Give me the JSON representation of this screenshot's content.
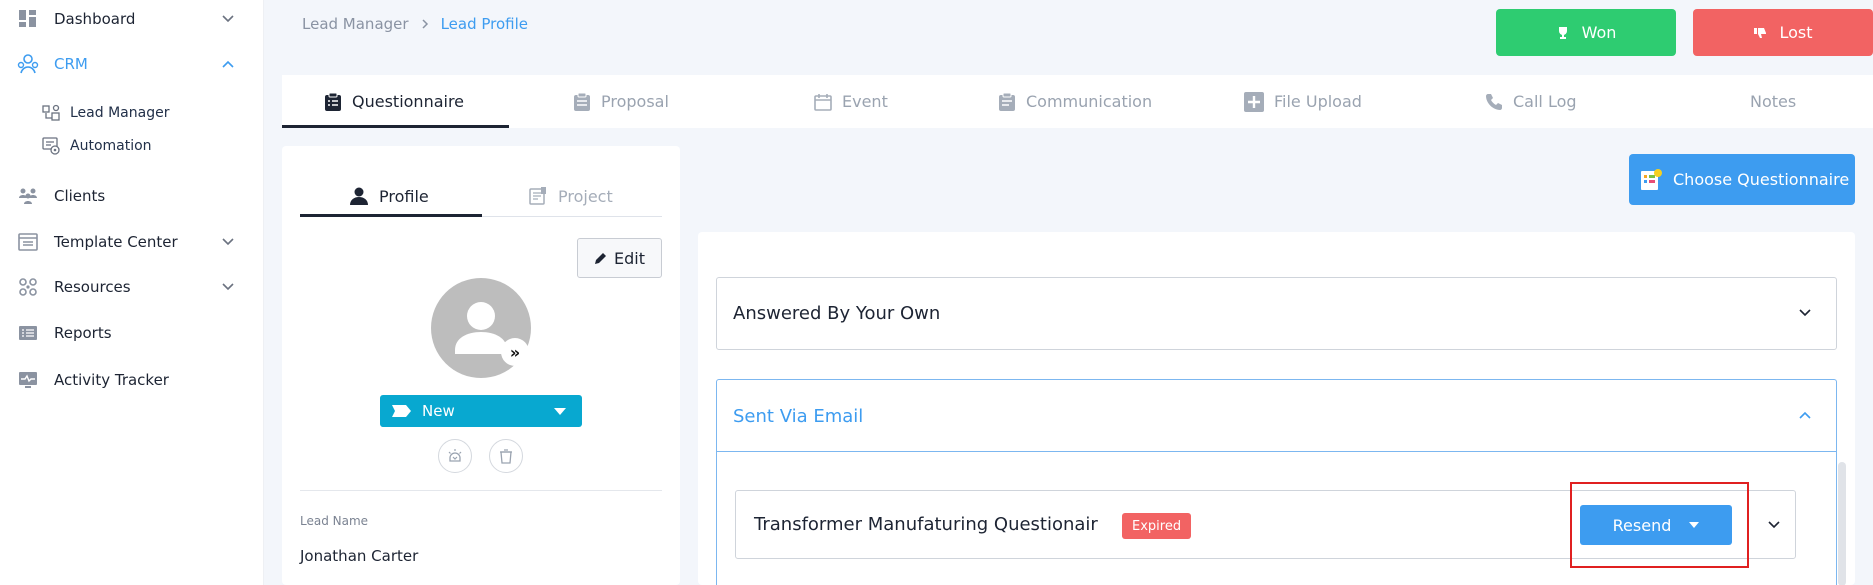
{
  "sidebar": {
    "items": [
      {
        "label": "Dashboard",
        "icon": "dashboard-icon"
      },
      {
        "label": "CRM",
        "icon": "crm-icon"
      },
      {
        "label": "Clients",
        "icon": "clients-icon"
      },
      {
        "label": "Template Center",
        "icon": "template-icon"
      },
      {
        "label": "Resources",
        "icon": "resources-icon"
      },
      {
        "label": "Reports",
        "icon": "reports-icon"
      },
      {
        "label": "Activity Tracker",
        "icon": "activity-icon"
      }
    ],
    "crm_sub": [
      {
        "label": "Lead Manager",
        "icon": "lead-manager-icon"
      },
      {
        "label": "Automation",
        "icon": "automation-icon"
      }
    ],
    "active_color": "#3d9cf0"
  },
  "breadcrumb": {
    "parent": "Lead Manager",
    "current": "Lead Profile"
  },
  "header_actions": {
    "won_label": "Won",
    "lost_label": "Lost",
    "won_color": "#2ecc71",
    "lost_color": "#f26363"
  },
  "tabs": [
    {
      "label": "Questionnaire",
      "active": true
    },
    {
      "label": "Proposal"
    },
    {
      "label": "Event"
    },
    {
      "label": "Communication"
    },
    {
      "label": "File Upload"
    },
    {
      "label": "Call Log"
    },
    {
      "label": "Notes"
    }
  ],
  "profile": {
    "tabs": [
      {
        "label": "Profile"
      },
      {
        "label": "Project"
      }
    ],
    "edit_label": "Edit",
    "status": "New",
    "status_color": "#08a8d0",
    "lead_name_label": "Lead Name",
    "lead_name": "Jonathan Carter"
  },
  "questionnaire": {
    "choose_label": "Choose Questionnaire",
    "sections": [
      {
        "title": "Answered By Your Own",
        "expanded": false
      },
      {
        "title": "Sent Via Email",
        "expanded": true
      }
    ],
    "items": [
      {
        "title": "Transformer Manufaturing Questionair",
        "badge": "Expired",
        "action_label": "Resend"
      }
    ]
  }
}
